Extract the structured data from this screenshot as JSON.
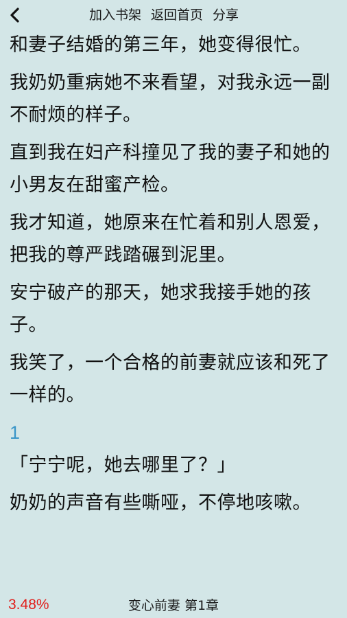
{
  "header": {
    "back_icon": "chevron-left-icon",
    "links": [
      "加入书架",
      "返回首页",
      "分享"
    ]
  },
  "content": {
    "paragraphs": [
      "和妻子结婚的第三年，她变得很忙。",
      "我奶奶重病她不来看望，对我永远一副不耐烦的样子。",
      "直到我在妇产科撞见了我的妻子和她的小男友在甜蜜产检。",
      "我才知道，她原来在忙着和别人恩爱，把我的尊严践踏碾到泥里。",
      "安宁破产的那天，她求我接手她的孩子。",
      "我笑了，一个合格的前妻就应该和死了一样的。"
    ],
    "chapter_number": "1",
    "paragraphs2": [
      "「宁宁呢，她去哪里了？」",
      "奶奶的声音有些嘶哑，不停地咳嗽。"
    ]
  },
  "footer": {
    "progress": "3.48%",
    "chapter_title": "变心前妻 第1章"
  },
  "colors": {
    "background": "#d3e6e7",
    "progress": "#e0201c",
    "chapter_number": "#3a96c8"
  }
}
